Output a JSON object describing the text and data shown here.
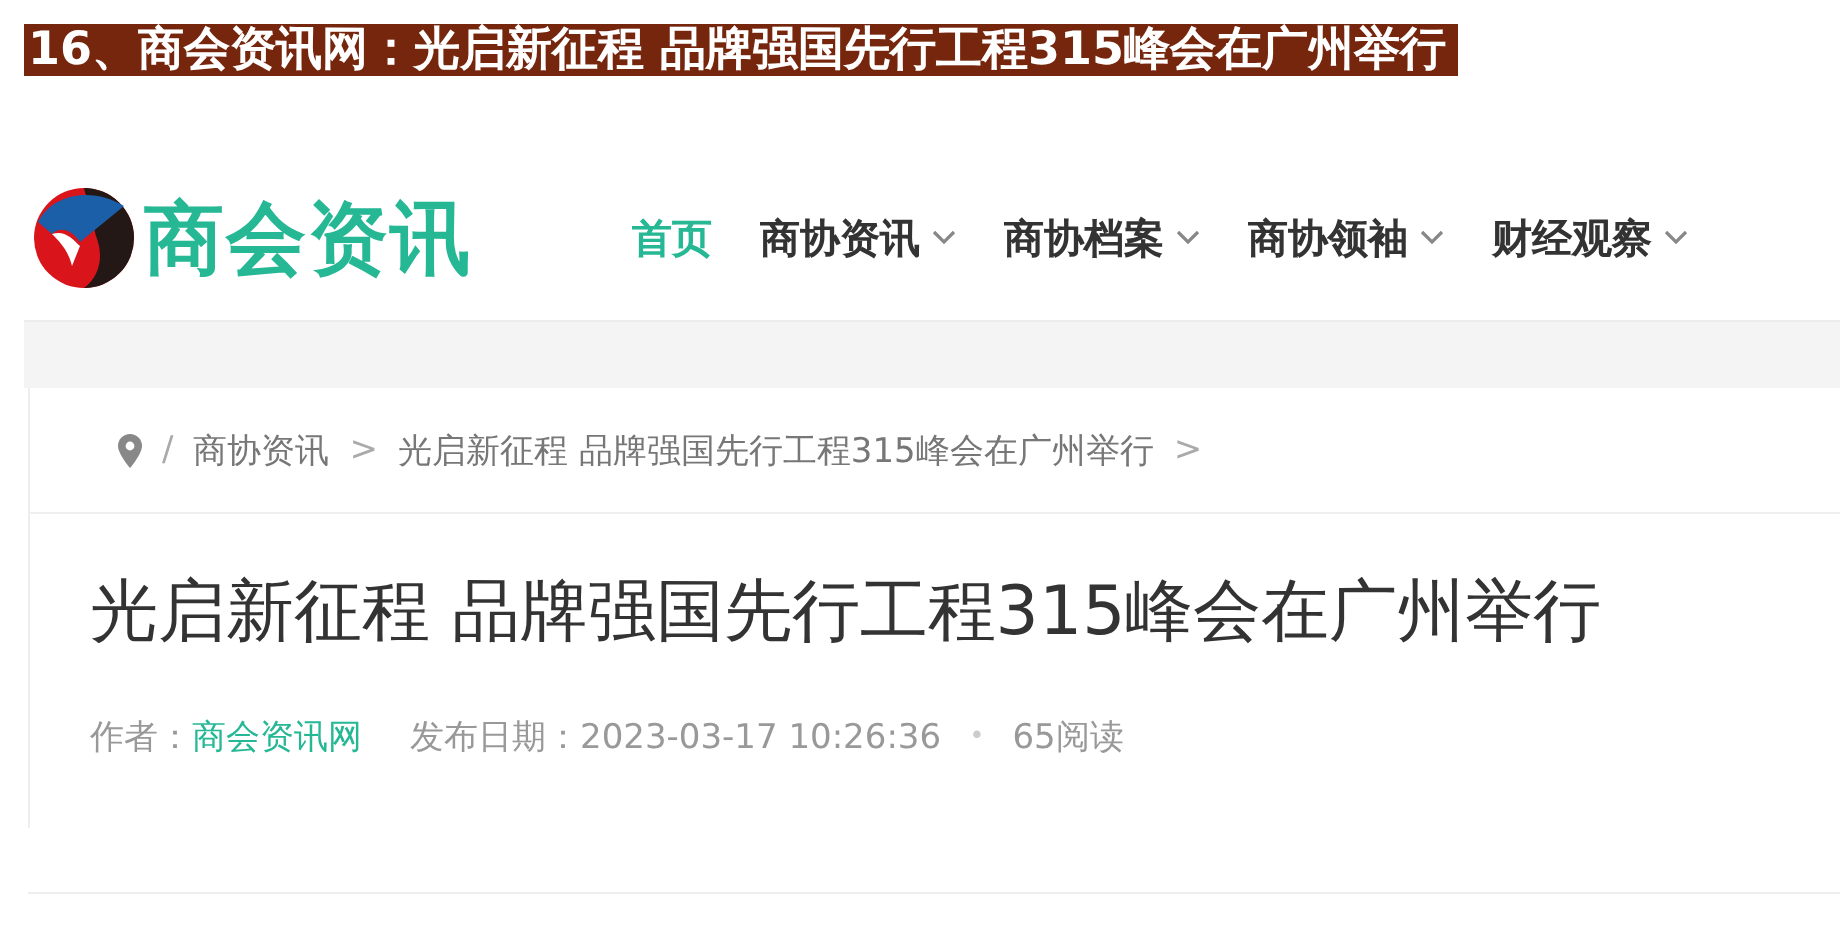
{
  "caption": "16、商会资讯网：光启新征程 品牌强国先行工程315峰会在广州举行",
  "logo": {
    "text": "商会资讯"
  },
  "nav": [
    {
      "label": "首页",
      "selected": true,
      "dropdown": false
    },
    {
      "label": "商协资讯",
      "selected": false,
      "dropdown": true
    },
    {
      "label": "商协档案",
      "selected": false,
      "dropdown": true
    },
    {
      "label": "商协领袖",
      "selected": false,
      "dropdown": true
    },
    {
      "label": "财经观察",
      "selected": false,
      "dropdown": true
    }
  ],
  "breadcrumb": {
    "separator": "/",
    "items": [
      {
        "label": "商协资讯"
      },
      {
        "label": "光启新征程 品牌强国先行工程315峰会在广州举行"
      }
    ],
    "arrow": ">"
  },
  "article": {
    "title": "光启新征程 品牌强国先行工程315峰会在广州举行",
    "author_label": "作者：",
    "author": "商会资讯网",
    "date_label": "发布日期：",
    "date": "2023-03-17 10:26:36",
    "dot": "•",
    "reads": "65阅读"
  }
}
